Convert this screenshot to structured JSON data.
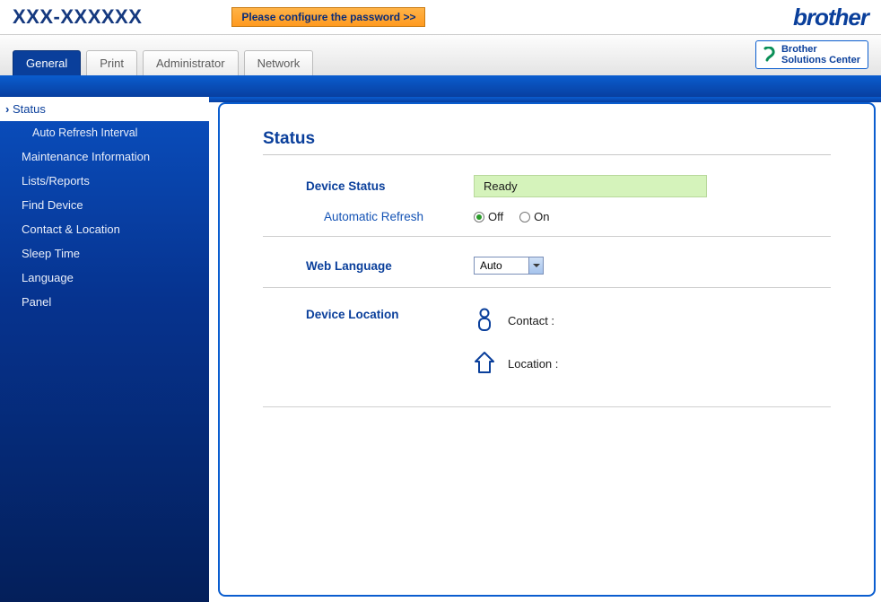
{
  "header": {
    "model": "XXX-XXXXXX",
    "password_banner": "Please configure the password >>",
    "logo_text": "brother",
    "solutions_center_line1": "Brother",
    "solutions_center_line2": "Solutions Center"
  },
  "tabs": [
    {
      "label": "General",
      "active": true
    },
    {
      "label": "Print",
      "active": false
    },
    {
      "label": "Administrator",
      "active": false
    },
    {
      "label": "Network",
      "active": false
    }
  ],
  "sidebar": {
    "items": [
      {
        "label": "Status",
        "active": true,
        "sub": false
      },
      {
        "label": "Auto Refresh Interval",
        "active": false,
        "sub": true
      },
      {
        "label": "Maintenance Information",
        "active": false,
        "sub": false
      },
      {
        "label": "Lists/Reports",
        "active": false,
        "sub": false
      },
      {
        "label": "Find Device",
        "active": false,
        "sub": false
      },
      {
        "label": "Contact & Location",
        "active": false,
        "sub": false
      },
      {
        "label": "Sleep Time",
        "active": false,
        "sub": false
      },
      {
        "label": "Language",
        "active": false,
        "sub": false
      },
      {
        "label": "Panel",
        "active": false,
        "sub": false
      }
    ]
  },
  "page": {
    "title": "Status",
    "device_status_label": "Device Status",
    "device_status_value": "Ready",
    "auto_refresh_label": "Automatic Refresh",
    "auto_refresh_options": {
      "off": "Off",
      "on": "On"
    },
    "auto_refresh_value": "off",
    "web_language_label": "Web Language",
    "web_language_value": "Auto",
    "device_location_label": "Device Location",
    "contact_label": "Contact :",
    "contact_value": "",
    "location_label": "Location :",
    "location_value": ""
  }
}
